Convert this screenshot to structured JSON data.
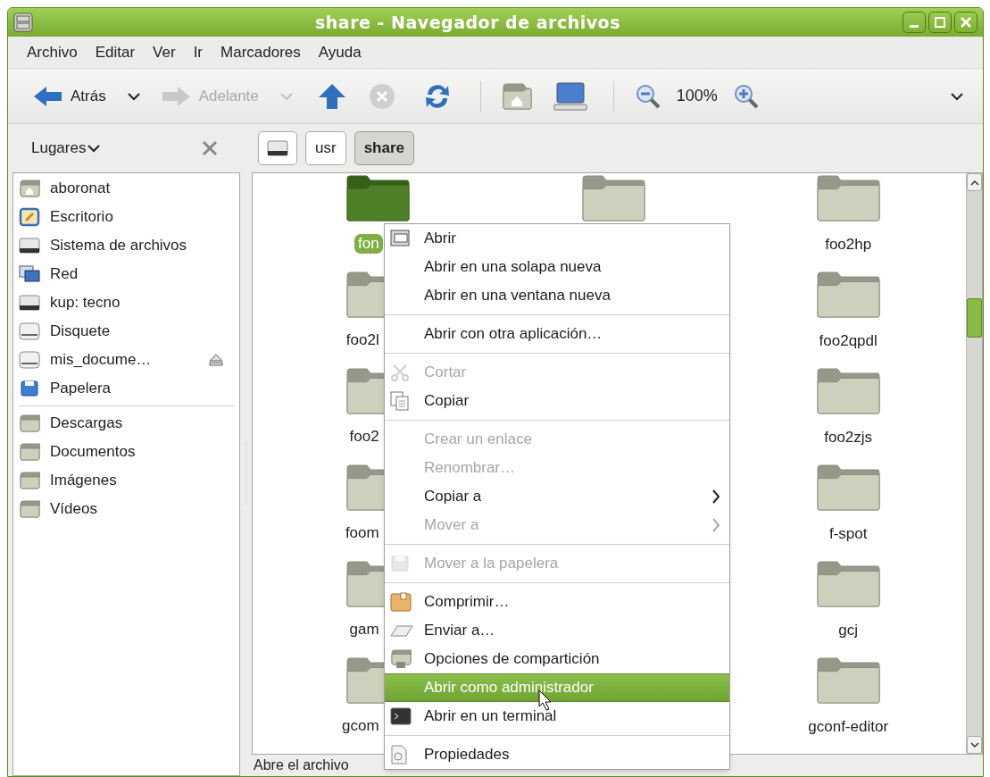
{
  "window": {
    "title": "share - Navegador de archivos"
  },
  "menubar": [
    {
      "label": "Archivo"
    },
    {
      "label": "Editar"
    },
    {
      "label": "Ver"
    },
    {
      "label": "Ir"
    },
    {
      "label": "Marcadores"
    },
    {
      "label": "Ayuda"
    }
  ],
  "toolbar": [
    {
      "kind": "back",
      "label": "Atrás",
      "disabled": false
    },
    {
      "kind": "history_menu",
      "disabled": false
    },
    {
      "kind": "forward",
      "label": "Adelante",
      "disabled": true
    },
    {
      "kind": "history_menu",
      "disabled": true
    },
    {
      "kind": "up",
      "disabled": false
    },
    {
      "kind": "stop",
      "disabled": true
    },
    {
      "kind": "reload",
      "disabled": false
    },
    {
      "kind": "separator"
    },
    {
      "kind": "home",
      "disabled": false
    },
    {
      "kind": "computer",
      "disabled": false
    },
    {
      "kind": "separator"
    },
    {
      "kind": "zoom_out",
      "disabled": false
    },
    {
      "kind": "zoom_level",
      "label": "100%"
    },
    {
      "kind": "zoom_in",
      "disabled": false
    },
    {
      "kind": "overflow",
      "disabled": false
    }
  ],
  "sidebar": {
    "title": "Lugares",
    "sections": [
      {
        "items": [
          {
            "kind": "home",
            "label": "aboronat",
            "eject": false
          },
          {
            "kind": "desktop",
            "label": "Escritorio",
            "eject": false
          },
          {
            "kind": "drive",
            "label": "Sistema de archivos",
            "eject": false
          },
          {
            "kind": "network",
            "label": "Red",
            "eject": false
          },
          {
            "kind": "drive",
            "label": "kup: tecno",
            "eject": false
          },
          {
            "kind": "disk",
            "label": "Disquete",
            "eject": false
          },
          {
            "kind": "disk",
            "label": "mis_docume…",
            "eject": true
          },
          {
            "kind": "trash",
            "label": "Papelera",
            "eject": false
          }
        ]
      },
      {
        "items": [
          {
            "kind": "folder",
            "label": "Descargas",
            "eject": false
          },
          {
            "kind": "folder",
            "label": "Documentos",
            "eject": false
          },
          {
            "kind": "folder",
            "label": "Imágenes",
            "eject": false
          },
          {
            "kind": "folder",
            "label": "Vídeos",
            "eject": false
          }
        ]
      }
    ]
  },
  "path_bar": [
    {
      "kind": "drive",
      "selected": false
    },
    {
      "kind": "folder",
      "label": "usr",
      "selected": false
    },
    {
      "kind": "folder",
      "label": "share",
      "selected": true
    }
  ],
  "files": {
    "columns": [
      {
        "items": [
          {
            "label": "fon",
            "selected": true
          },
          {
            "label": "foo2l",
            "selected": false
          },
          {
            "label": "foo2",
            "selected": false
          },
          {
            "label": "foom",
            "selected": false
          },
          {
            "label": "gam",
            "selected": false
          },
          {
            "label": "gcom",
            "selected": false
          }
        ]
      },
      {
        "items": [
          {
            "selected": false
          }
        ]
      },
      {
        "items": [
          {
            "label": "foo2hp",
            "selected": false
          },
          {
            "label": "foo2qpdl",
            "selected": false
          },
          {
            "label": "foo2zjs",
            "selected": false
          },
          {
            "label": "f-spot",
            "selected": false
          },
          {
            "label": "gcj",
            "selected": false
          },
          {
            "label": "gconf-editor",
            "selected": false
          }
        ]
      }
    ]
  },
  "status_bar": {
    "text": "Abre el archivo"
  },
  "context_menu": [
    {
      "kind": "open",
      "label": "Abrir",
      "disabled": false,
      "selected": false,
      "submenu": false
    },
    {
      "kind": "plain",
      "label": "Abrir en una solapa nueva",
      "disabled": false,
      "selected": false,
      "submenu": false
    },
    {
      "kind": "plain",
      "label": "Abrir en una ventana nueva",
      "disabled": false,
      "selected": false,
      "submenu": false
    },
    {
      "kind": "separator"
    },
    {
      "kind": "plain",
      "label": "Abrir con otra aplicación…",
      "disabled": false,
      "selected": false,
      "submenu": false
    },
    {
      "kind": "separator"
    },
    {
      "kind": "scissors",
      "label": "Cortar",
      "disabled": true,
      "selected": false,
      "submenu": false
    },
    {
      "kind": "copy",
      "label": "Copiar",
      "disabled": false,
      "selected": false,
      "submenu": false
    },
    {
      "kind": "separator"
    },
    {
      "kind": "plain",
      "label": "Crear un enlace",
      "disabled": true,
      "selected": false,
      "submenu": false
    },
    {
      "kind": "plain",
      "label": "Renombrar…",
      "disabled": true,
      "selected": false,
      "submenu": false
    },
    {
      "kind": "plain",
      "label": "Copiar a",
      "disabled": false,
      "selected": false,
      "submenu": true
    },
    {
      "kind": "plain",
      "label": "Mover a",
      "disabled": true,
      "selected": false,
      "submenu": true
    },
    {
      "kind": "separator"
    },
    {
      "kind": "trash",
      "label": "Mover a la papelera",
      "disabled": true,
      "selected": false,
      "submenu": false
    },
    {
      "kind": "separator"
    },
    {
      "kind": "archive",
      "label": "Comprimir…",
      "disabled": false,
      "selected": false,
      "submenu": false
    },
    {
      "kind": "send",
      "label": "Enviar a…",
      "disabled": false,
      "selected": false,
      "submenu": false
    },
    {
      "kind": "share",
      "label": "Opciones de compartición",
      "disabled": false,
      "selected": false,
      "submenu": false
    },
    {
      "kind": "plain",
      "label": "Abrir como administrador",
      "disabled": false,
      "selected": true,
      "submenu": false
    },
    {
      "kind": "terminal",
      "label": "Abrir en un terminal",
      "disabled": false,
      "selected": false,
      "submenu": false
    },
    {
      "kind": "separator"
    },
    {
      "kind": "properties",
      "label": "Propiedades",
      "disabled": false,
      "selected": false,
      "submenu": false
    }
  ]
}
